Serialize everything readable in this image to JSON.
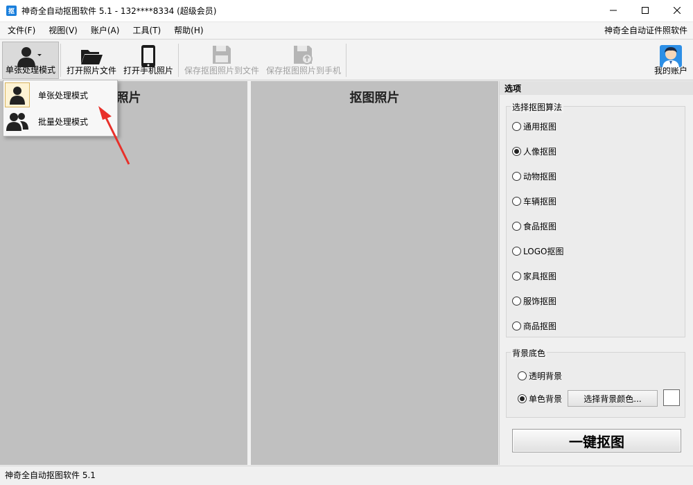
{
  "titlebar": {
    "icon_glyph": "抠",
    "title": "神奇全自动抠图软件 5.1 - 132****8334 (超级会员)"
  },
  "menubar": {
    "items": [
      "文件(F)",
      "视图(V)",
      "账户(A)",
      "工具(T)",
      "帮助(H)"
    ],
    "right_link": "神奇全自动证件照软件"
  },
  "toolbar": {
    "single_mode": "单张处理模式",
    "open_file": "打开照片文件",
    "open_phone": "打开手机照片",
    "save_to_file": "保存抠图照片到文件",
    "save_to_phone": "保存抠图照片到手机",
    "my_account": "我的账户"
  },
  "dropdown": {
    "items": [
      "单张处理模式",
      "批量处理模式"
    ]
  },
  "panes": {
    "original_title_visible": "照片",
    "cutout_title": "抠图照片"
  },
  "options": {
    "header": "选项",
    "algo_group": "选择抠图算法",
    "algorithms": [
      "通用抠图",
      "人像抠图",
      "动物抠图",
      "车辆抠图",
      "食品抠图",
      "LOGO抠图",
      "家具抠图",
      "服饰抠图",
      "商品抠图"
    ],
    "selected_algorithm": "人像抠图",
    "bg_group": "背景底色",
    "bg_transparent": "透明背景",
    "bg_solid": "单色背景",
    "pick_color": "选择背景颜色...",
    "swatch_color": "#ffffff",
    "one_key": "一键抠图"
  },
  "statusbar": {
    "text": "神奇全自动抠图软件 5.1"
  },
  "colors": {
    "accent": "#1a7fdc",
    "pane_bg": "#c0c0c0",
    "arrow": "#e8302a"
  }
}
